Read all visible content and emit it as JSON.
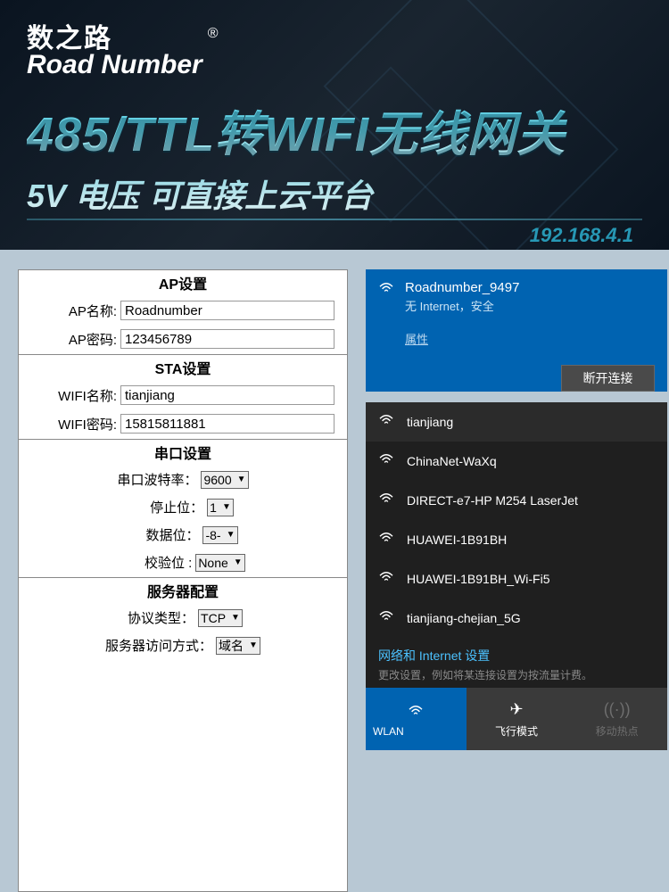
{
  "header": {
    "brand_cn": "数之路",
    "brand_en": "Road Number",
    "reg": "®",
    "title_main": "485/TTL转WIFI无线网关",
    "title_sub": "5V 电压 可直接上云平台",
    "ip": "192.168.4.1"
  },
  "config": {
    "ap": {
      "title": "AP设置",
      "name_label": "AP名称:",
      "name_value": "Roadnumber",
      "pass_label": "AP密码:",
      "pass_value": "123456789"
    },
    "sta": {
      "title": "STA设置",
      "name_label": "WIFI名称:",
      "name_value": "tianjiang",
      "pass_label": "WIFI密码:",
      "pass_value": "15815811881"
    },
    "serial": {
      "title": "串口设置",
      "baud_label": "串口波特率：",
      "baud_value": "9600",
      "stop_label": "停止位：",
      "stop_value": "1",
      "data_label": "数据位：",
      "data_value": "-8-",
      "parity_label": "校验位 :",
      "parity_value": "None"
    },
    "server": {
      "title": "服务器配置",
      "proto_label": "协议类型：",
      "proto_value": "TCP",
      "access_label": "服务器访问方式：",
      "access_value": "域名"
    }
  },
  "wifi": {
    "connected": {
      "ssid": "Roadnumber_9497",
      "status": "无 Internet，安全",
      "properties": "属性",
      "disconnect": "断开连接"
    },
    "networks": [
      {
        "ssid": "tianjiang"
      },
      {
        "ssid": "ChinaNet-WaXq"
      },
      {
        "ssid": "DIRECT-e7-HP M254 LaserJet"
      },
      {
        "ssid": "HUAWEI-1B91BH"
      },
      {
        "ssid": "HUAWEI-1B91BH_Wi-Fi5"
      },
      {
        "ssid": "tianjiang-chejian_5G"
      }
    ],
    "settings_link": "网络和 Internet 设置",
    "settings_desc": "更改设置，例如将某连接设置为按流量计费。",
    "tiles": {
      "wlan": "WLAN",
      "airplane": "飞行模式",
      "hotspot": "移动热点"
    }
  }
}
